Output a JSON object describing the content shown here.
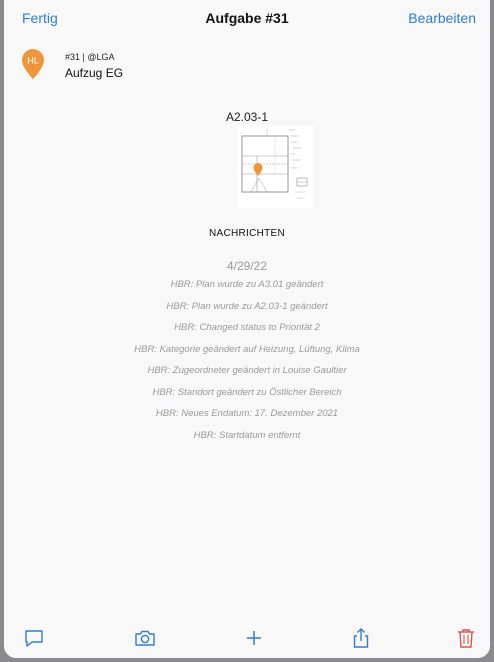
{
  "navbar": {
    "left_label": "Fertig",
    "title": "Aufgabe #31",
    "right_label": "Bearbeiten"
  },
  "task": {
    "avatar_initials": "HL",
    "avatar_color": "#f0963a",
    "meta": "#31 | @LGA",
    "name": "Aufzug EG"
  },
  "plan": {
    "title": "A2.03-1"
  },
  "messages": {
    "section_title": "NACHRICHTEN",
    "date": "4/29/22",
    "items": [
      "HBR: Plan wurde zu A3.01 geändert",
      "HBR: Plan wurde zu A2.03-1 geändert",
      "HBR: Changed status to Priorität 2",
      "HBR: Kategorie geändert auf Heizung, Lüftung, Klima",
      "HBR: Zugeordneter geändert in Louise Gaultier",
      "HBR: Standort geändert zu Östlicher Bereich",
      "HBR: Neues Endatum: 17. Dezember 2021",
      "HBR: Startdatum entfernt"
    ]
  },
  "toolbar": {
    "icons": [
      "comment-icon",
      "camera-icon",
      "plus-icon",
      "share-icon",
      "trash-icon"
    ],
    "accent_color": "#2f7dd2",
    "delete_color": "#d9534f"
  }
}
